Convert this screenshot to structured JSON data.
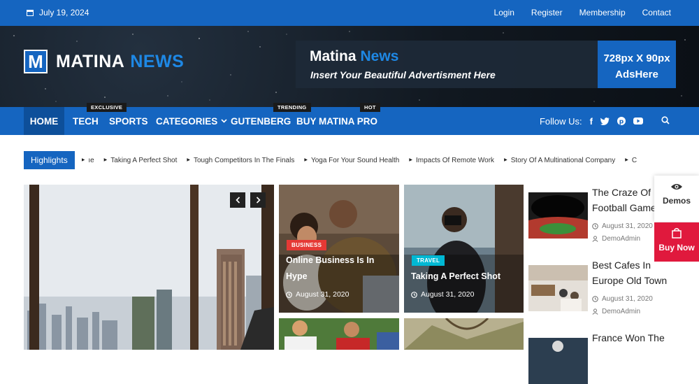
{
  "topbar": {
    "date": "July 19, 2024",
    "links": [
      "Login",
      "Register",
      "Membership",
      "Contact"
    ]
  },
  "logo": {
    "letter": "M",
    "word1": "MATINA",
    "word2": "NEWS"
  },
  "ad": {
    "title1": "Matina",
    "title2": "News",
    "subtitle": "Insert Your Beautiful Advertisment Here",
    "box_line1": "728px X 90px",
    "box_line2": "AdsHere"
  },
  "nav": {
    "items": [
      "HOME",
      "TECH",
      "SPORTS",
      "CATEGORIES",
      "GUTENBERG",
      "BUY MATINA PRO"
    ],
    "badges": {
      "tech": "EXCLUSIVE",
      "gutenberg": "TRENDING",
      "pro": "HOT"
    },
    "follow_label": "Follow Us:"
  },
  "ticker": {
    "label": "Highlights",
    "items": [
      "ıe",
      "Taking A Perfect Shot",
      "Tough Competitors In The Finals",
      "Yoga For Your Sound Health",
      "Impacts Of Remote Work",
      "Story Of A Multinational Company",
      "C"
    ]
  },
  "cards": [
    {
      "category": "BUSINESS",
      "title_line1": "Online Business Is In",
      "title_line2": "Hype",
      "date": "August 31, 2020"
    },
    {
      "category": "TRAVEL",
      "title_line1": "Taking A Perfect Shot",
      "title_line2": "",
      "date": "August 31, 2020"
    }
  ],
  "sidebar_posts": [
    {
      "title_line1": "The Craze Of",
      "title_line2": "Football Game",
      "date": "August 31, 2020",
      "author": "DemoAdmin"
    },
    {
      "title_line1": "Best Cafes In",
      "title_line2": "Europe Old Town",
      "date": "August 31, 2020",
      "author": "DemoAdmin"
    },
    {
      "title_line1": "France Won The",
      "title_line2": "",
      "date": "",
      "author": ""
    }
  ],
  "floating": {
    "demos": "Demos",
    "buy_now": "Buy Now"
  },
  "colors": {
    "brand_blue": "#1565c0",
    "business_red": "#e53935",
    "travel_cyan": "#00b8d4",
    "buy_now_red": "#e0193d"
  }
}
